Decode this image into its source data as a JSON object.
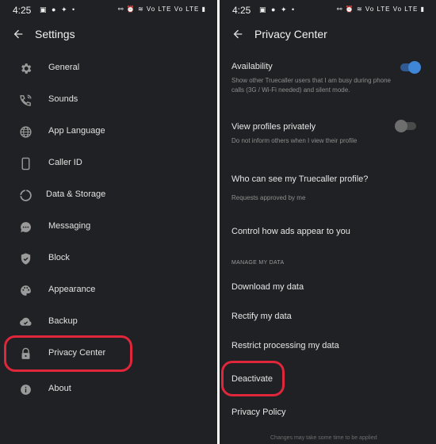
{
  "left": {
    "status": {
      "time": "4:25",
      "right_icons": "⚯ ⏰ ≋ Vo LTE  Vo LTE ▮"
    },
    "title": "Settings",
    "items": [
      {
        "label": "General",
        "icon": "gear-icon"
      },
      {
        "label": "Sounds",
        "icon": "phone-sound-icon"
      },
      {
        "label": "App Language",
        "icon": "globe-icon"
      },
      {
        "label": "Caller ID",
        "icon": "phone-device-icon"
      },
      {
        "label": "Data & Storage",
        "icon": "data-usage-icon"
      },
      {
        "label": "Messaging",
        "icon": "chat-bubble-icon"
      },
      {
        "label": "Block",
        "icon": "shield-check-icon"
      },
      {
        "label": "Appearance",
        "icon": "palette-icon"
      },
      {
        "label": "Backup",
        "icon": "cloud-check-icon"
      },
      {
        "label": "Privacy Center",
        "icon": "lock-icon"
      },
      {
        "label": "About",
        "icon": "info-icon"
      }
    ]
  },
  "right": {
    "status": {
      "time": "4:25",
      "right_icons": "⚯ ⏰ ≋ Vo LTE  Vo LTE ▮"
    },
    "title": "Privacy Center",
    "availability": {
      "title": "Availability",
      "subtitle": "Show other Truecaller users that I am busy during phone calls (3G / Wi-Fi needed) and silent mode.",
      "enabled": true
    },
    "view_privately": {
      "title": "View profiles privately",
      "subtitle": "Do not inform others when I view their profile",
      "enabled": false
    },
    "who_can_see": {
      "title": "Who can see my Truecaller profile?",
      "subtitle": "Requests approved by me"
    },
    "control_ads": "Control how ads appear to you",
    "manage_header": "MANAGE MY DATA",
    "download": "Download my data",
    "rectify": "Rectify my data",
    "restrict": "Restrict processing my data",
    "deactivate": "Deactivate",
    "privacy_policy": "Privacy Policy",
    "footer": "Changes may take some time to be applied"
  },
  "colors": {
    "highlight": "#e0263a",
    "toggle_on": "#3f86d6",
    "background": "#202124"
  }
}
